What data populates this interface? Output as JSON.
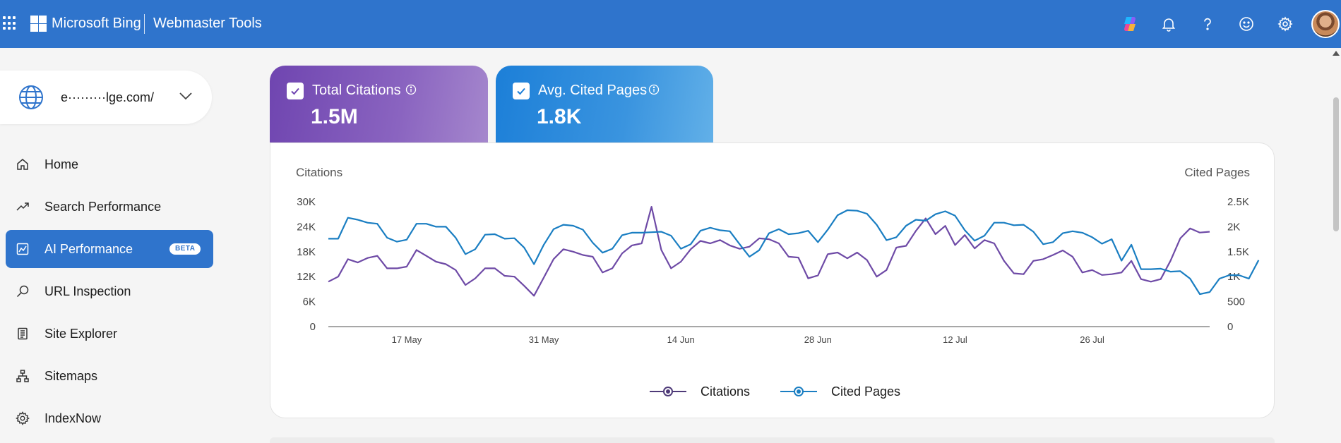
{
  "header": {
    "brand": "Microsoft Bing",
    "product": "Webmaster Tools",
    "icons": [
      "copilot-icon",
      "bell-icon",
      "help-icon",
      "feedback-icon",
      "gear-icon",
      "avatar"
    ],
    "background": "#2f74cc"
  },
  "site": {
    "name": "e·········lge.com/"
  },
  "sidebar": {
    "items": [
      {
        "label": "Home",
        "icon": "home-icon"
      },
      {
        "label": "Search Performance",
        "icon": "trend-icon"
      },
      {
        "label": "AI Performance",
        "icon": "ai-chart-icon",
        "badge": "BETA",
        "active": true
      },
      {
        "label": "URL Inspection",
        "icon": "search-icon"
      },
      {
        "label": "Site Explorer",
        "icon": "document-icon"
      },
      {
        "label": "Sitemaps",
        "icon": "sitemap-icon"
      },
      {
        "label": "IndexNow",
        "icon": "gear-icon"
      }
    ],
    "active_color": "#2f74cc"
  },
  "metrics": [
    {
      "label": "Total Citations",
      "value": "1.5M",
      "checked": true,
      "color": "#7046b1"
    },
    {
      "label": "Avg. Cited Pages",
      "value": "1.8K",
      "checked": true,
      "color": "#1f80d8"
    }
  ],
  "chart_data": {
    "type": "line",
    "ylabel_left": "Citations",
    "ylabel_right": "Cited Pages",
    "ylim_left": [
      0,
      30000
    ],
    "ylim_right": [
      0,
      2500
    ],
    "yticks_left": [
      "0",
      "6K",
      "12K",
      "18K",
      "24K",
      "30K"
    ],
    "yticks_right": [
      "0",
      "500",
      "1K",
      "1.5K",
      "2K",
      "2.5K"
    ],
    "xtick_labels": [
      "17 May",
      "31 May",
      "14 Jun",
      "28 Jun",
      "12 Jul",
      "26 Jul"
    ],
    "xtick_index": [
      8,
      22,
      36,
      50,
      64,
      78
    ],
    "series": [
      {
        "name": "Citations",
        "axis": "left",
        "color": "#6e4aa6",
        "values": [
          10800,
          12000,
          16200,
          15400,
          16500,
          17000,
          14000,
          14000,
          14400,
          18400,
          17000,
          15600,
          15000,
          13600,
          10000,
          11600,
          14000,
          14000,
          12200,
          12000,
          9800,
          7400,
          11800,
          16200,
          18600,
          18000,
          17200,
          16800,
          13000,
          14000,
          17600,
          19500,
          20000,
          28800,
          18400,
          14000,
          15600,
          18600,
          20600,
          20000,
          20800,
          19500,
          18700,
          19200,
          21200,
          21000,
          20000,
          16800,
          16600,
          11600,
          12300,
          17400,
          17800,
          16400,
          17800,
          16000,
          12000,
          13600,
          19000,
          19400,
          23000,
          26000,
          22200,
          24200,
          19600,
          22000,
          18800,
          20800,
          20000,
          15800,
          12800,
          12600,
          15800,
          16200,
          17200,
          18300,
          16800,
          13000,
          13600,
          12400,
          12600,
          13000,
          15800,
          11400,
          10800,
          11400,
          15800,
          21200,
          23600,
          22600,
          22800
        ]
      },
      {
        "name": "Cited Pages",
        "axis": "right",
        "color": "#1a7ec2",
        "values": [
          1760,
          1760,
          2180,
          2140,
          2080,
          2060,
          1780,
          1700,
          1740,
          2060,
          2060,
          2000,
          2000,
          1780,
          1450,
          1550,
          1840,
          1850,
          1760,
          1770,
          1580,
          1250,
          1640,
          1950,
          2040,
          2020,
          1940,
          1680,
          1480,
          1560,
          1830,
          1880,
          1880,
          1890,
          1900,
          1820,
          1560,
          1650,
          1920,
          1980,
          1930,
          1910,
          1650,
          1400,
          1530,
          1870,
          1950,
          1850,
          1870,
          1920,
          1690,
          1940,
          2230,
          2330,
          2320,
          2260,
          2040,
          1730,
          1790,
          2020,
          2140,
          2120,
          2250,
          2310,
          2220,
          1930,
          1720,
          1820,
          2080,
          2080,
          2030,
          2040,
          1900,
          1650,
          1690,
          1870,
          1910,
          1880,
          1790,
          1660,
          1750,
          1320,
          1640,
          1150,
          1150,
          1160,
          1100,
          1110,
          960,
          650,
          690,
          960,
          1030,
          1030,
          960,
          1330
        ]
      }
    ],
    "legend": [
      "Citations",
      "Cited Pages"
    ],
    "legend_position": "bottom",
    "grid": false
  }
}
